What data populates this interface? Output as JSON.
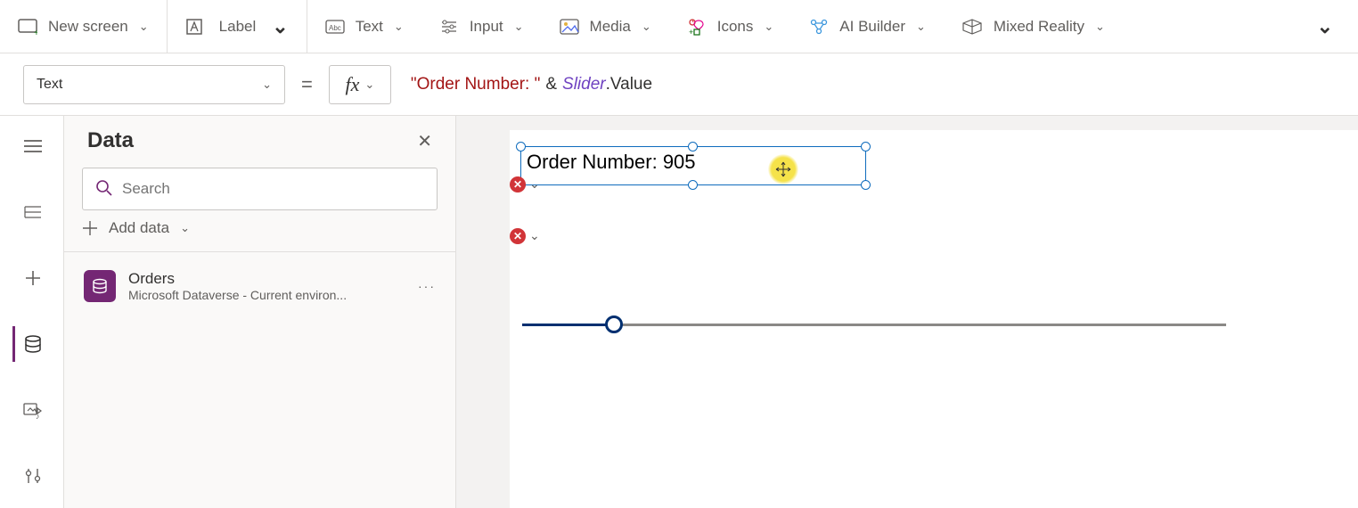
{
  "cmdbar": {
    "new_screen": "New screen",
    "label": "Label",
    "text": "Text",
    "input": "Input",
    "media": "Media",
    "icons": "Icons",
    "ai_builder": "AI Builder",
    "mixed_reality": "Mixed Reality"
  },
  "formula_bar": {
    "property": "Text",
    "equals": "=",
    "formula_tokens": {
      "string": "\"Order Number: \"",
      "op": "&",
      "object": "Slider",
      "dot": ".",
      "prop": "Value"
    }
  },
  "data_panel": {
    "title": "Data",
    "search_placeholder": "Search",
    "add_data": "Add data",
    "sources": [
      {
        "name": "Orders",
        "subtitle": "Microsoft Dataverse - Current environ..."
      }
    ]
  },
  "canvas": {
    "label_text": "Order Number: 905",
    "slider": {
      "min": 0,
      "max": 100,
      "value": 13
    },
    "error_glyph": "✕"
  }
}
